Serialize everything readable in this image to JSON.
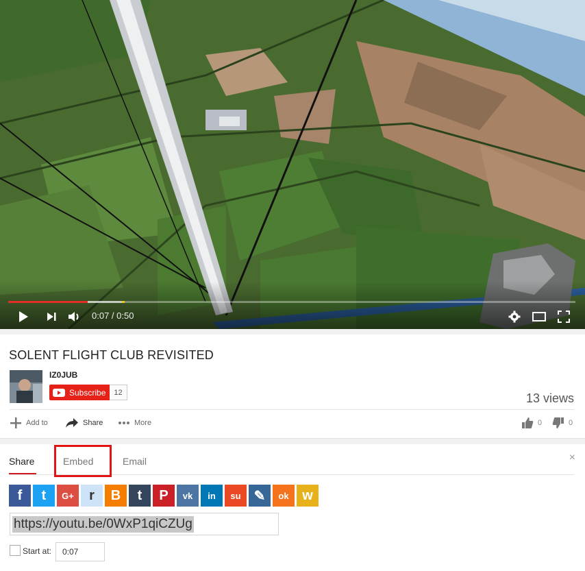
{
  "player": {
    "time_display": "0:07 / 0:50",
    "played_fraction": 0.14,
    "loaded_fraction": 0.2
  },
  "video": {
    "title": "SOLENT FLIGHT CLUB REVISITED",
    "channel": "IZ0JUB",
    "subscribe_label": "Subscribe",
    "subscriber_count": "12",
    "views": "13 views"
  },
  "actions": {
    "add_to": "Add to",
    "share": "Share",
    "more": "More",
    "likes": "0",
    "dislikes": "0"
  },
  "share_panel": {
    "tabs": [
      "Share",
      "Embed",
      "Email"
    ],
    "active_tab": "Share",
    "close_symbol": "×",
    "url": "https://youtu.be/0WxP1qiCZUg",
    "start_at_label": "Start at:",
    "start_at_value": "0:07",
    "networks": [
      {
        "name": "facebook-icon",
        "glyph": "f",
        "color": "#3b5998"
      },
      {
        "name": "twitter-icon",
        "glyph": "t",
        "color": "#1da1f2"
      },
      {
        "name": "google-plus-icon",
        "glyph": "G+",
        "color": "#dc4e41"
      },
      {
        "name": "reddit-icon",
        "glyph": "r",
        "color": "#cee3f8"
      },
      {
        "name": "blogger-icon",
        "glyph": "B",
        "color": "#f57d00"
      },
      {
        "name": "tumblr-icon",
        "glyph": "t",
        "color": "#35465c"
      },
      {
        "name": "pinterest-icon",
        "glyph": "P",
        "color": "#cb2027"
      },
      {
        "name": "vk-icon",
        "glyph": "vk",
        "color": "#4c75a3"
      },
      {
        "name": "linkedin-icon",
        "glyph": "in",
        "color": "#0077b5"
      },
      {
        "name": "stumbleupon-icon",
        "glyph": "su",
        "color": "#eb4924"
      },
      {
        "name": "livejournal-icon",
        "glyph": "✎",
        "color": "#366797"
      },
      {
        "name": "odnoklassniki-icon",
        "glyph": "ok",
        "color": "#f4731c"
      },
      {
        "name": "mixi-icon",
        "glyph": "w",
        "color": "#e6b11b"
      }
    ]
  },
  "colors": {
    "accent_red": "#e62117",
    "highlight_box": "#e01414"
  }
}
